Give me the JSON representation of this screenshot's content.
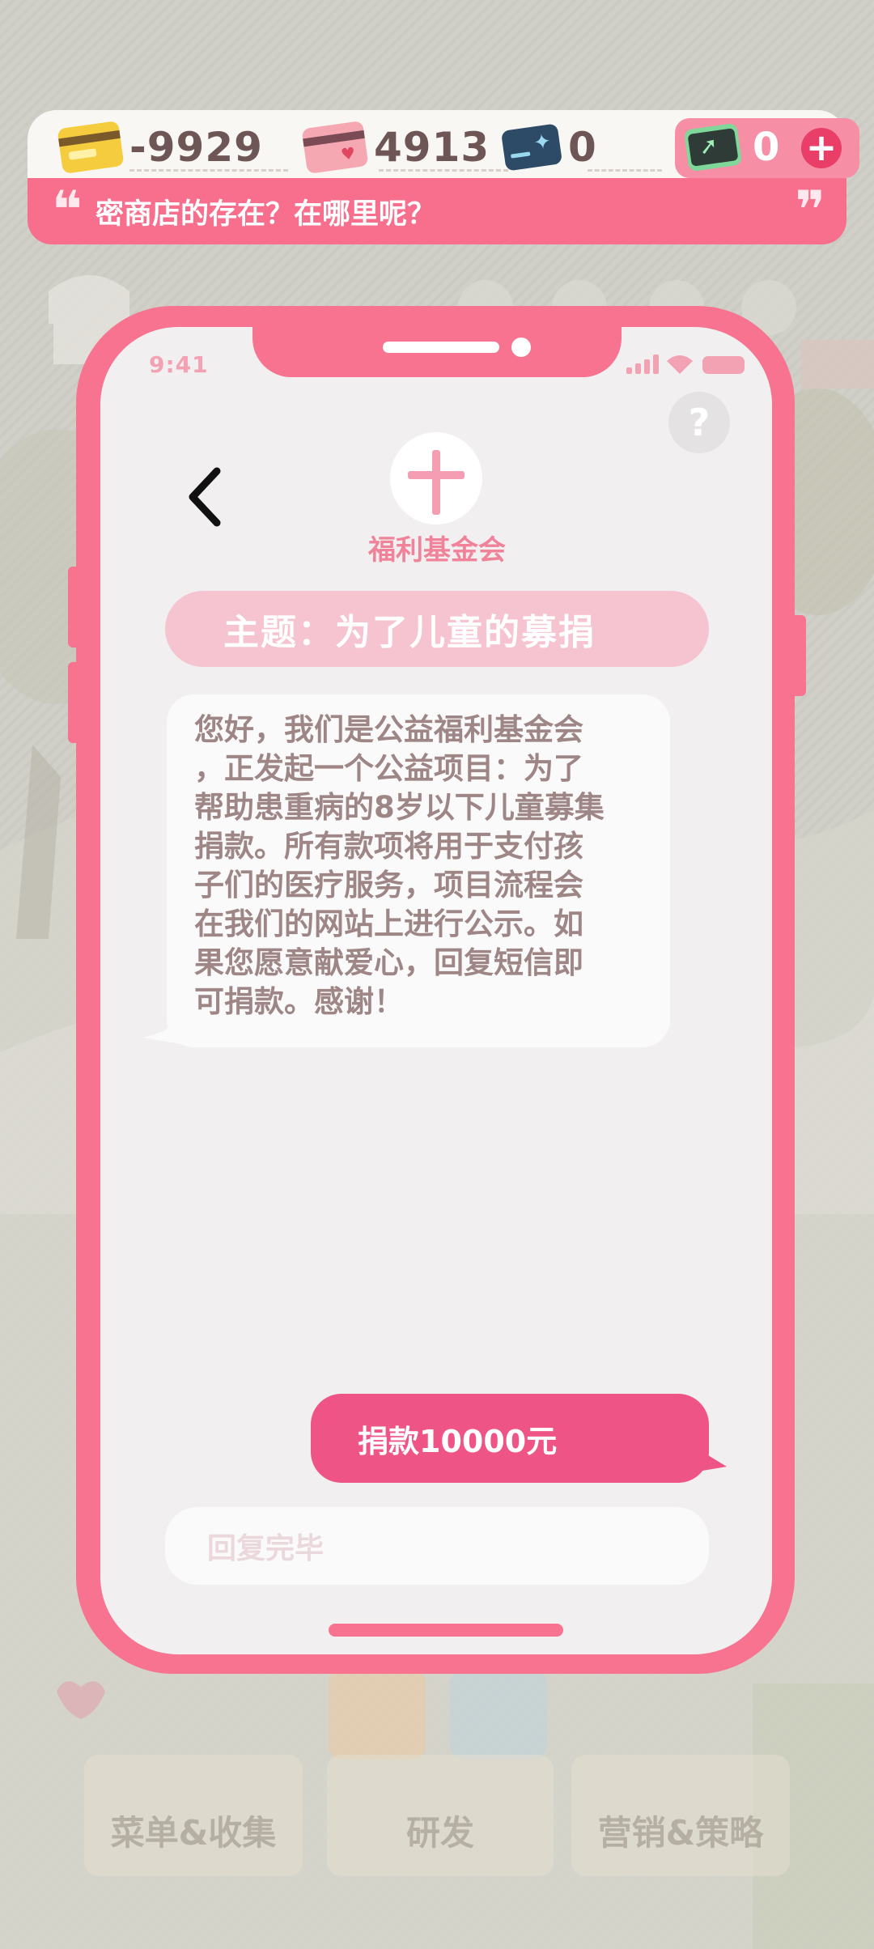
{
  "currency": {
    "money": {
      "value": "-9929",
      "icon": "gold-card-icon"
    },
    "reputation": {
      "value": "4913",
      "icon": "heart-card-icon"
    },
    "ticket": {
      "value": "0",
      "icon": "dark-card-icon"
    },
    "cash": {
      "value": "0",
      "icon": "green-cash-icon",
      "add_icon": "plus-icon"
    }
  },
  "quote": {
    "text": "密商店的存在？在哪里呢？",
    "open_mark": "❝",
    "close_mark": "❞"
  },
  "phone": {
    "time": "9:41",
    "help_label": "?",
    "back_icon": "chevron-left-icon",
    "org_name": "福利基金会",
    "org_logo_icon": "cross-icon",
    "subject": "主题：为了儿童的募捐",
    "message": "您好，我们是公益福利基金会\n，正发起一个公益项目：为了\n帮助患重病的8岁以下儿童募集\n捐款。所有款项将用于支付孩\n子们的医疗服务，项目流程会\n在我们的网站上进行公示。如\n果您愿意献爱心，回复短信即\n可捐款。感谢！",
    "reply_option": "捐款10000元",
    "reply_placeholder": "回复完毕"
  },
  "background_menu": {
    "recipes": "菜单&收集",
    "research": "研发",
    "marketing": "营销&策略"
  },
  "colors": {
    "accent": "#f7738f",
    "button": "#ee5486",
    "subject": "#f5c4d0",
    "message_text": "#9e8686"
  }
}
